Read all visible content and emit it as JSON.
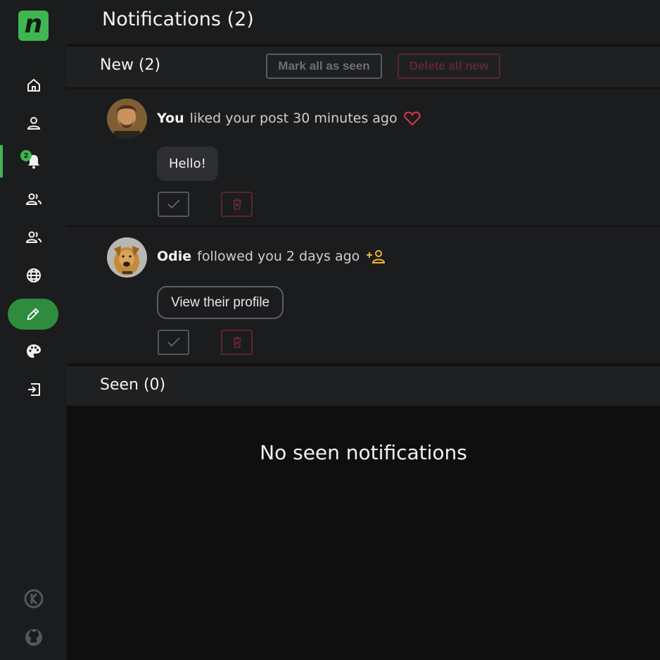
{
  "header": {
    "title": "Notifications (2)"
  },
  "sidebar": {
    "logo": "n",
    "badge": "2",
    "items": [
      {
        "name": "home",
        "icon": "home-icon"
      },
      {
        "name": "profile",
        "icon": "user-icon"
      },
      {
        "name": "notifications",
        "icon": "bell-icon"
      },
      {
        "name": "followers",
        "icon": "people-icon"
      },
      {
        "name": "following",
        "icon": "people-icon"
      },
      {
        "name": "explore",
        "icon": "globe-icon"
      },
      {
        "name": "write",
        "icon": "pencil-icon"
      },
      {
        "name": "theme",
        "icon": "palette-icon"
      },
      {
        "name": "logout",
        "icon": "logout-icon"
      }
    ]
  },
  "new_section": {
    "title": "New (2)",
    "mark_all_label": "Mark all as seen",
    "delete_all_label": "Delete all new"
  },
  "notifications": [
    {
      "who": "You",
      "text": "liked your post 30 minutes ago",
      "icon": "heart-icon",
      "content": "Hello!"
    },
    {
      "who": "Odie",
      "text": "followed you 2 days ago",
      "icon": "person-add-icon",
      "content": "View their profile"
    }
  ],
  "seen_section": {
    "title": "Seen (0)",
    "empty_text": "No seen notifications"
  },
  "colors": {
    "accent": "#3fb651",
    "like": "#e0334d",
    "follow": "#f0b429",
    "danger": "#5a2630"
  }
}
